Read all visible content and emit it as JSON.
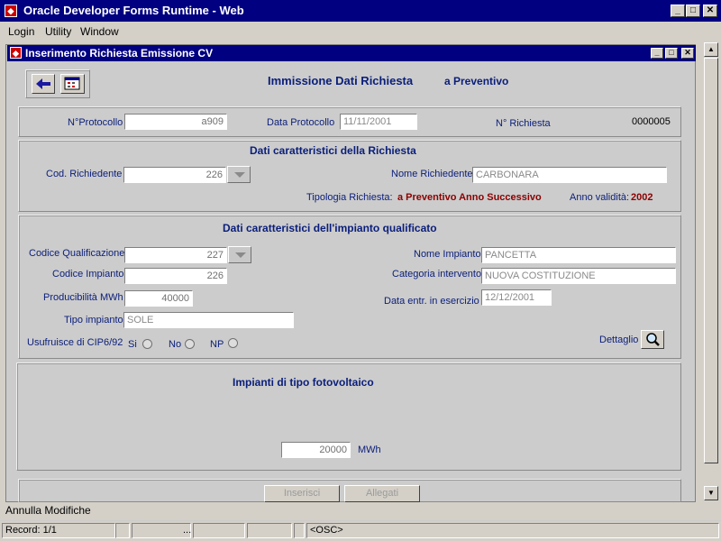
{
  "app": {
    "title": "Oracle Developer Forms Runtime - Web"
  },
  "menu": [
    "Login",
    "Utility",
    "Window"
  ],
  "form": {
    "title": "Inserimento Richiesta Emissione CV"
  },
  "header": {
    "title": "Immissione Dati Richiesta",
    "subtitle": "a Preventivo"
  },
  "protocol": {
    "num_label": "N°Protocollo",
    "num_value": "a909",
    "date_label": "Data Protocollo",
    "date_value": "11/11/2001",
    "req_label": "N° Richiesta",
    "req_value": "0000005"
  },
  "request": {
    "heading": "Dati caratteristici della Richiesta",
    "cod_label": "Cod. Richiedente",
    "cod_value": "226",
    "name_label": "Nome Richiedente",
    "name_value": "CARBONARA",
    "type_label": "Tipologia Richiesta:",
    "type_value": "a Preventivo Anno Successivo",
    "year_label": "Anno validità:",
    "year_value": "2002"
  },
  "plant": {
    "heading": "Dati caratteristici dell'impianto qualificato",
    "qual_label": "Codice Qualificazione",
    "qual_value": "227",
    "code_label": "Codice Impianto",
    "code_value": "226",
    "prod_label": "Producibilità MWh",
    "prod_value": "40000",
    "kind_label": "Tipo impianto",
    "kind_value": "SOLE",
    "cip_label": "Usufruisce di CIP6/92",
    "radio_si": "Si",
    "radio_no": "No",
    "radio_np": "NP",
    "name_label": "Nome Impianto",
    "name_value": "PANCETTA",
    "cat_label": "Categoria intervento",
    "cat_value": "NUOVA COSTITUZIONE",
    "date_label": "Data entr. in esercizio",
    "date_value": "12/12/2001",
    "detail_label": "Dettaglio"
  },
  "photo": {
    "heading": "Impianti di tipo fotovoltaico",
    "value": "20000",
    "unit": "MWh"
  },
  "buttons": {
    "insert": "Inserisci",
    "attach": "Allegati"
  },
  "status": {
    "message": "Annulla Modifiche",
    "record": "Record: 1/1",
    "dots": "...",
    "osc": "<OSC>"
  },
  "icons": [
    "app-icon",
    "back-arrow-icon",
    "calendar-icon",
    "magnifier-icon"
  ],
  "colors": {
    "titlebar": "#000080",
    "label": "#0a1e7a",
    "accent_red": "#8b0000"
  }
}
